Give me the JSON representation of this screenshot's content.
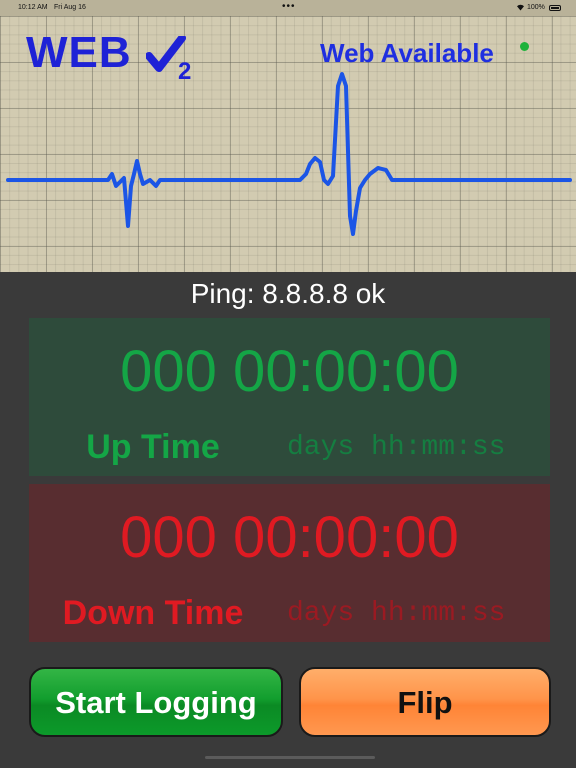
{
  "status_bar": {
    "time": "10:12 AM",
    "date": "Fri Aug 16",
    "battery": "100%",
    "dots": "•••"
  },
  "monitor": {
    "logo_text": "WEB",
    "logo_subscript": "2",
    "availability_text": "Web Available",
    "availability_color": "#1db23a",
    "trace_color": "#1b55e6"
  },
  "ping": {
    "text": "Ping: 8.8.8.8 ok"
  },
  "up": {
    "counter": "000 00:00:00",
    "label": "Up Time",
    "format": "days hh:mm:ss",
    "color": "#14a646"
  },
  "down": {
    "counter": "000 00:00:00",
    "label": "Down Time",
    "format": "days hh:mm:ss",
    "color": "#e01a22"
  },
  "buttons": {
    "start_logging": "Start Logging",
    "flip": "Flip"
  }
}
